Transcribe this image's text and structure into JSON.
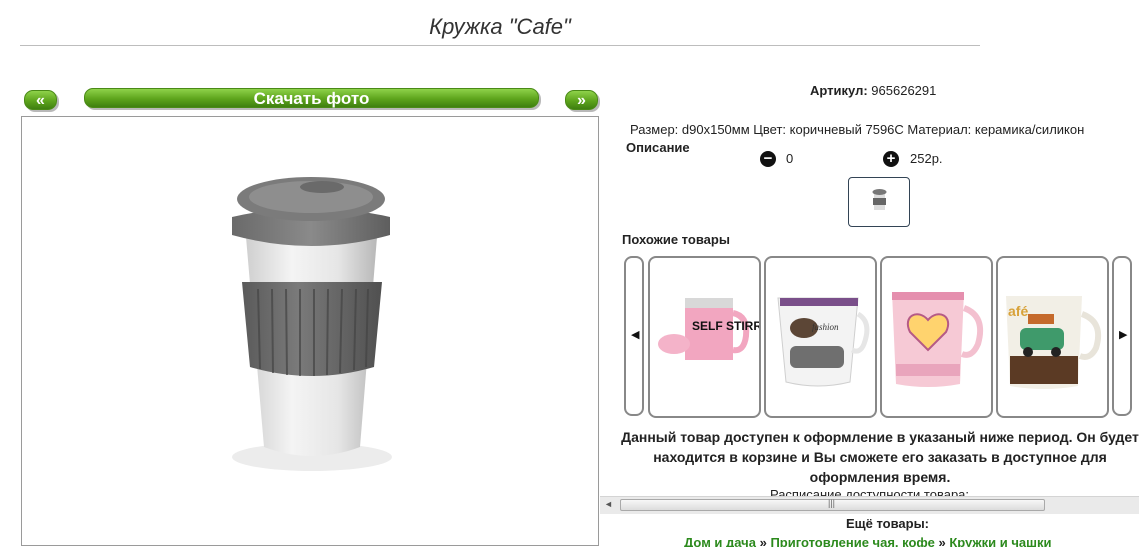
{
  "product": {
    "title": "Кружка \"Cafe\"",
    "article_label": "Артикул:",
    "article_value": "965626291",
    "properties": "Размер: d90x150мм Цвет: коричневый 7596C Материал: керамика/силикон",
    "description_label": "Описание",
    "quantity": "0",
    "price": "252р."
  },
  "gallery": {
    "prev_label": "«",
    "download_label": "Скачать фото",
    "next_label": "»"
  },
  "similar": {
    "title": "Похожие товары",
    "items": [
      {
        "icon": "self-stirring-mug-image",
        "text": "SELF STIRRING MUG"
      },
      {
        "icon": "fashion-mug-image",
        "text": "fashion"
      },
      {
        "icon": "heart-mug-image",
        "text": ""
      },
      {
        "icon": "cafe-car-mug-image",
        "text": "afé"
      }
    ]
  },
  "notice": {
    "text": "Данный товар доступен к оформление в указаный ниже период. Он будет находится в корзине и Вы сможете его заказать в доступное для оформления время.",
    "schedule": "Расписание доступности товара:"
  },
  "more": {
    "title": "Ещё товары:",
    "crumbs": [
      "Дом и дача",
      "Приготовление чая, кофе",
      "Кружки и чашки"
    ],
    "separator": "»"
  },
  "colors": {
    "accent_green": "#5da41c",
    "link_green": "#2c8a1d"
  }
}
